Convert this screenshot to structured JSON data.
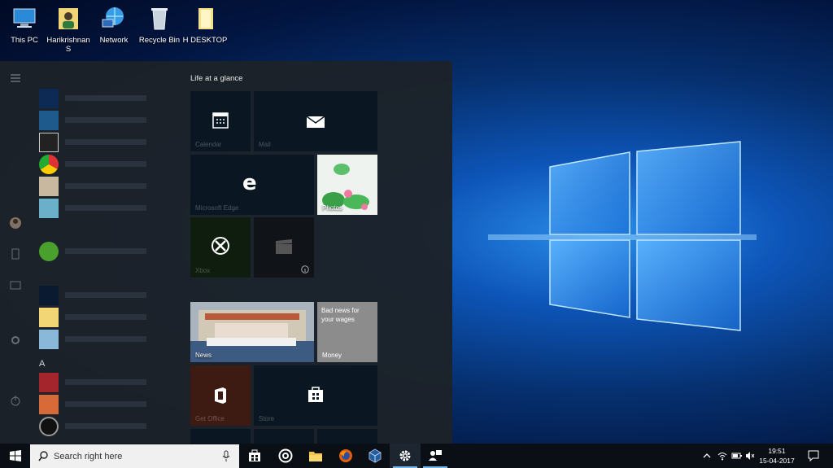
{
  "desktop": {
    "icons": [
      {
        "label": "This PC",
        "icon": "this-pc-icon"
      },
      {
        "label": "Harikrishnan S",
        "icon": "user-folder-icon"
      },
      {
        "label": "Network",
        "icon": "network-icon"
      },
      {
        "label": "Recycle Bin",
        "icon": "recycle-bin-icon"
      },
      {
        "label": "H DESKTOP",
        "icon": "folder-icon"
      }
    ]
  },
  "start_menu": {
    "section_letter_a": "A",
    "tiles_group_title": "Life at a glance",
    "tiles": {
      "calendar": "Calendar",
      "mail": "Mail",
      "edge": "Microsoft Edge",
      "photos": "Photos",
      "xbox": "Xbox",
      "news": "News",
      "money_headline": "Bad news for your wages",
      "money": "Money",
      "get_office": "Get Office",
      "store": "Store"
    }
  },
  "taskbar": {
    "search_placeholder": "Search right here",
    "clock_time": "19:51",
    "clock_date": "15-04-2017"
  },
  "colors": {
    "accent": "#0078d7",
    "office_tile": "#3d1a12",
    "xbox_tile": "#0e1d0e"
  }
}
